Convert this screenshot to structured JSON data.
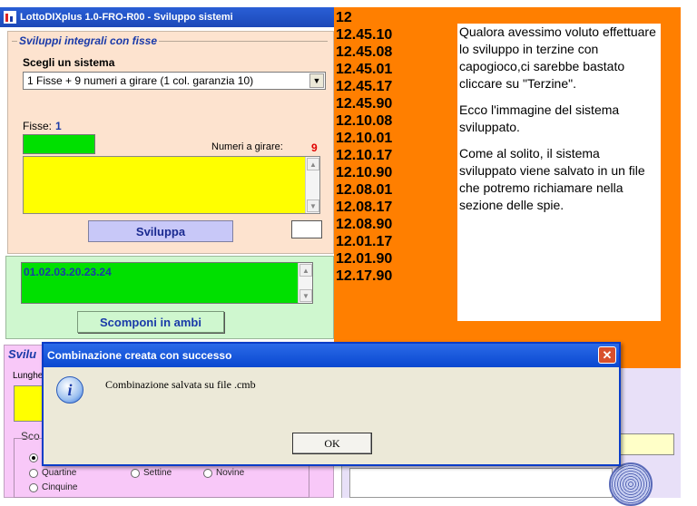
{
  "app": {
    "title": "LottoDIXplus 1.0-FRO-R00 - Sviluppo sistemi"
  },
  "sviluppi": {
    "legend": "Sviluppi integrali con fisse",
    "scegli_label": "Scegli un sistema",
    "combo_value": "1 Fisse + 9 numeri a girare (1 col. garanzia 10)",
    "fisse_label": "Fisse:",
    "fisse_value": "1",
    "numeri_label": "Numeri a girare:",
    "numeri_value": "9",
    "sviluppa_label": "Sviluppa"
  },
  "ambi": {
    "numbers": "01.02.03.20.23.24",
    "scomponi_label": "Scomponi in ambi"
  },
  "section3": {
    "legend": "Svilu",
    "lunghe_label": "Lunghe",
    "sco_label": "Sco",
    "radios": [
      {
        "label": "Quartine"
      },
      {
        "label": "Settine"
      },
      {
        "label": "Novine"
      },
      {
        "label": "Cinquine"
      }
    ]
  },
  "numbers_list": [
    "12",
    "12.45.10",
    "12.45.08",
    "12.45.01",
    "12.45.17",
    "12.45.90",
    "12.10.08",
    "12.10.01",
    "12.10.17",
    "12.10.90",
    "12.08.01",
    "12.08.17",
    "12.08.90",
    "12.01.17",
    "12.01.90",
    "12.17.90"
  ],
  "note": {
    "p1": "Qualora avessimo voluto effettuare lo sviluppo in terzine con capogioco,ci sarebbe bastato cliccare su \"Terzine\".",
    "p2": "Ecco l'immagine del sistema sviluppato.",
    "p3": "Come al solito, il sistema sviluppato viene salvato in un file che potremo richiamare nella sezione delle spie."
  },
  "dialog": {
    "title": "Combinazione creata con successo",
    "message": "Combinazione salvata su file .cmb",
    "ok_label": "OK",
    "close_glyph": "✕",
    "icon_glyph": "i"
  },
  "colors": {
    "accent_orange": "#ff7f00",
    "title_blue": "#1c48b8",
    "red_value": "#e00000"
  }
}
